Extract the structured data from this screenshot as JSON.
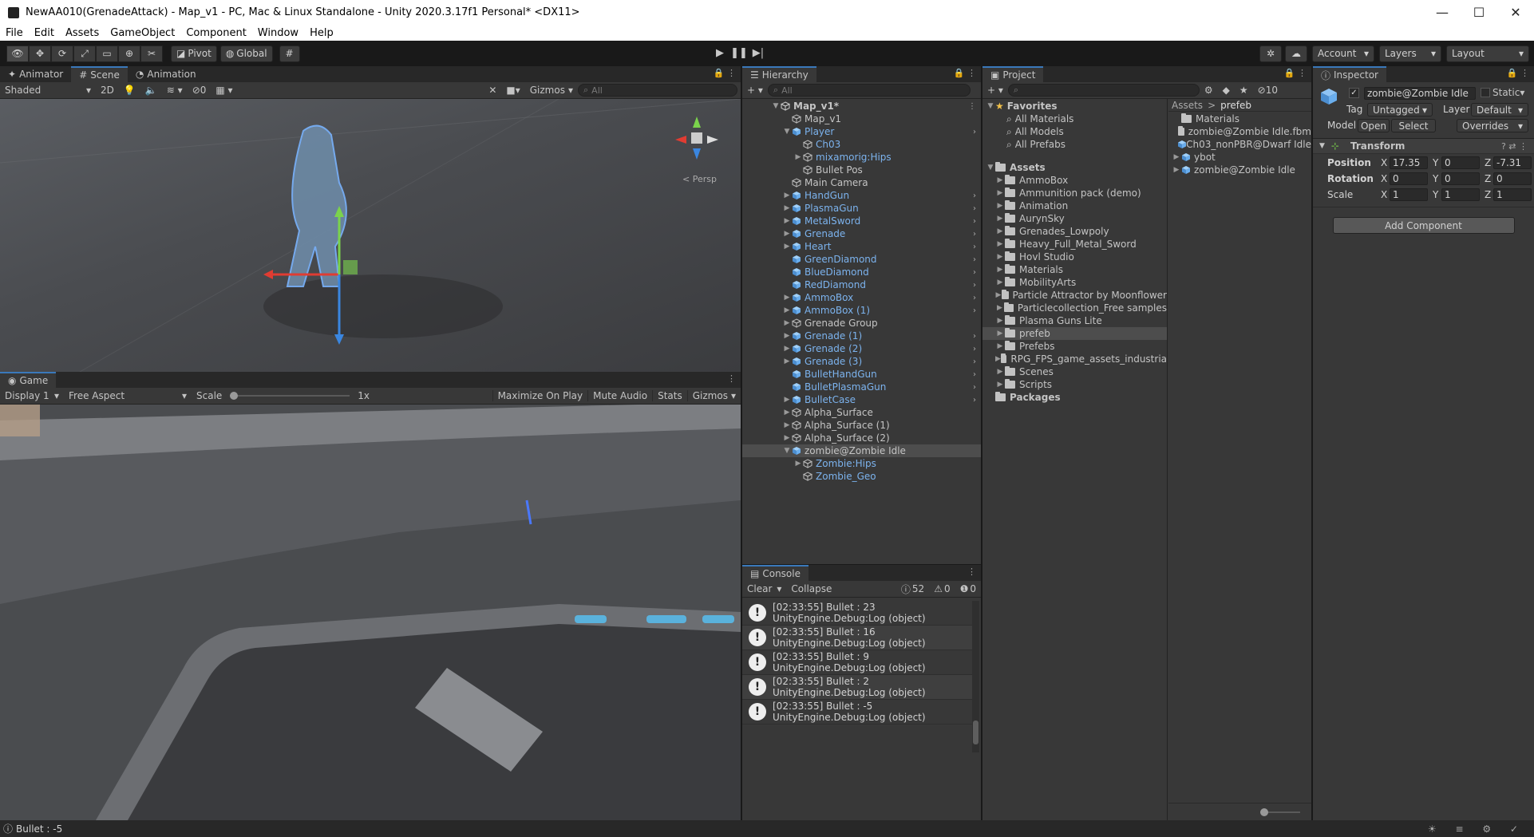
{
  "window": {
    "title": "NewAA010(GrenadeAttack) - Map_v1 - PC, Mac & Linux Standalone - Unity 2020.3.17f1 Personal* <DX11>",
    "minimize": "—",
    "maximize": "☐",
    "close": "✕"
  },
  "menu": [
    "File",
    "Edit",
    "Assets",
    "GameObject",
    "Component",
    "Window",
    "Help"
  ],
  "toolbar": {
    "pivot": "Pivot",
    "global": "Global",
    "account": "Account",
    "layers": "Layers",
    "layout": "Layout"
  },
  "scene": {
    "tabs": [
      "Animator",
      "Scene",
      "Animation"
    ],
    "shading": "Shaded",
    "mode2d": "2D",
    "hidden_count": "0",
    "gizmos": "Gizmos",
    "search_placeholder": "All",
    "persp": "< Persp"
  },
  "game": {
    "tab": "Game",
    "display": "Display 1",
    "aspect": "Free Aspect",
    "scale_label": "Scale",
    "scale_value": "1x",
    "maximize": "Maximize On Play",
    "mute": "Mute Audio",
    "stats": "Stats",
    "gizmos": "Gizmos"
  },
  "hierarchy": {
    "tab": "Hierarchy",
    "search_placeholder": "All",
    "items": [
      {
        "label": "Map_v1*",
        "indent": 0,
        "arrow": "▼",
        "icon": "scene",
        "bold": true
      },
      {
        "label": "Map_v1",
        "indent": 1,
        "arrow": "",
        "icon": "cube"
      },
      {
        "label": "Player",
        "indent": 1,
        "arrow": "▼",
        "icon": "prefab",
        "blue": true,
        "chev": true
      },
      {
        "label": "Ch03",
        "indent": 2,
        "arrow": "",
        "icon": "cube",
        "blue": true
      },
      {
        "label": "mixamorig:Hips",
        "indent": 2,
        "arrow": "▶",
        "icon": "cube",
        "blue": true
      },
      {
        "label": "Bullet Pos",
        "indent": 2,
        "arrow": "",
        "icon": "cube"
      },
      {
        "label": "Main Camera",
        "indent": 1,
        "arrow": "",
        "icon": "cube"
      },
      {
        "label": "HandGun",
        "indent": 1,
        "arrow": "▶",
        "icon": "prefab",
        "blue": true,
        "chev": true
      },
      {
        "label": "PlasmaGun",
        "indent": 1,
        "arrow": "▶",
        "icon": "prefab",
        "blue": true,
        "chev": true
      },
      {
        "label": "MetalSword",
        "indent": 1,
        "arrow": "▶",
        "icon": "prefab",
        "blue": true,
        "chev": true
      },
      {
        "label": "Grenade",
        "indent": 1,
        "arrow": "▶",
        "icon": "prefab",
        "blue": true,
        "chev": true
      },
      {
        "label": "Heart",
        "indent": 1,
        "arrow": "▶",
        "icon": "prefab",
        "blue": true,
        "chev": true
      },
      {
        "label": "GreenDiamond",
        "indent": 1,
        "arrow": "",
        "icon": "prefab",
        "blue": true,
        "chev": true
      },
      {
        "label": "BlueDiamond",
        "indent": 1,
        "arrow": "",
        "icon": "prefab",
        "blue": true,
        "chev": true
      },
      {
        "label": "RedDiamond",
        "indent": 1,
        "arrow": "",
        "icon": "prefab",
        "blue": true,
        "chev": true
      },
      {
        "label": "AmmoBox",
        "indent": 1,
        "arrow": "▶",
        "icon": "prefab",
        "blue": true,
        "chev": true
      },
      {
        "label": "AmmoBox (1)",
        "indent": 1,
        "arrow": "▶",
        "icon": "prefab",
        "blue": true,
        "chev": true
      },
      {
        "label": "Grenade Group",
        "indent": 1,
        "arrow": "▶",
        "icon": "cube"
      },
      {
        "label": "Grenade (1)",
        "indent": 1,
        "arrow": "▶",
        "icon": "prefab",
        "blue": true,
        "chev": true
      },
      {
        "label": "Grenade (2)",
        "indent": 1,
        "arrow": "▶",
        "icon": "prefab",
        "blue": true,
        "chev": true
      },
      {
        "label": "Grenade (3)",
        "indent": 1,
        "arrow": "▶",
        "icon": "prefab",
        "blue": true,
        "chev": true
      },
      {
        "label": "BulletHandGun",
        "indent": 1,
        "arrow": "",
        "icon": "prefab",
        "blue": true,
        "chev": true
      },
      {
        "label": "BulletPlasmaGun",
        "indent": 1,
        "arrow": "",
        "icon": "prefab",
        "blue": true,
        "chev": true
      },
      {
        "label": "BulletCase",
        "indent": 1,
        "arrow": "▶",
        "icon": "prefab",
        "blue": true,
        "chev": true
      },
      {
        "label": "Alpha_Surface",
        "indent": 1,
        "arrow": "▶",
        "icon": "cube"
      },
      {
        "label": "Alpha_Surface (1)",
        "indent": 1,
        "arrow": "▶",
        "icon": "cube"
      },
      {
        "label": "Alpha_Surface (2)",
        "indent": 1,
        "arrow": "▶",
        "icon": "cube"
      },
      {
        "label": "zombie@Zombie Idle",
        "indent": 1,
        "arrow": "▼",
        "icon": "prefab",
        "selected": true
      },
      {
        "label": "Zombie:Hips",
        "indent": 2,
        "arrow": "▶",
        "icon": "cube",
        "blue": true
      },
      {
        "label": "Zombie_Geo",
        "indent": 2,
        "arrow": "",
        "icon": "cube",
        "blue": true
      }
    ]
  },
  "project": {
    "tab": "Project",
    "hidden_count": "10",
    "favorites_label": "Favorites",
    "favorites": [
      "All Materials",
      "All Models",
      "All Prefabs"
    ],
    "assets_label": "Assets",
    "folders": [
      "AmmoBox",
      "Ammunition pack (demo)",
      "Animation",
      "AurynSky",
      "Grenades_Lowpoly",
      "Heavy_Full_Metal_Sword",
      "Hovl Studio",
      "Materials",
      "MobilityArts",
      "Particle Attractor by Moonflower",
      "Particlecollection_Free samples",
      "Plasma Guns Lite",
      "prefeb",
      "Prefebs",
      "RPG_FPS_game_assets_industria",
      "Scenes",
      "Scripts"
    ],
    "selected_folder": "prefeb",
    "packages_label": "Packages",
    "breadcrumb_root": "Assets",
    "breadcrumb_sep": ">",
    "breadcrumb_current": "prefeb",
    "contents": [
      {
        "label": "Materials",
        "icon": "folder"
      },
      {
        "label": "zombie@Zombie Idle.fbm",
        "icon": "folder"
      },
      {
        "label": "Ch03_nonPBR@Dwarf Idle",
        "icon": "prefab"
      },
      {
        "label": "ybot",
        "icon": "prefab",
        "arrow": true
      },
      {
        "label": "zombie@Zombie Idle",
        "icon": "prefab",
        "arrow": true
      }
    ]
  },
  "console": {
    "tab": "Console",
    "clear": "Clear",
    "collapse": "Collapse",
    "log_count": "52",
    "warn_count": "0",
    "error_count": "0",
    "messages": [
      {
        "line1": "[02:33:55] Bullet : 23",
        "line2": "UnityEngine.Debug:Log (object)"
      },
      {
        "line1": "[02:33:55] Bullet : 16",
        "line2": "UnityEngine.Debug:Log (object)"
      },
      {
        "line1": "[02:33:55] Bullet : 9",
        "line2": "UnityEngine.Debug:Log (object)"
      },
      {
        "line1": "[02:33:55] Bullet : 2",
        "line2": "UnityEngine.Debug:Log (object)"
      },
      {
        "line1": "[02:33:55] Bullet : -5",
        "line2": "UnityEngine.Debug:Log (object)"
      }
    ]
  },
  "inspector": {
    "tab": "Inspector",
    "object_name": "zombie@Zombie Idle",
    "static": "Static",
    "tag_label": "Tag",
    "tag": "Untagged",
    "layer_label": "Layer",
    "layer": "Default",
    "model_label": "Model",
    "open": "Open",
    "select": "Select",
    "overrides": "Overrides",
    "transform_label": "Transform",
    "position_label": "Position",
    "position": {
      "x": "17.35",
      "y": "0",
      "z": "-7.31"
    },
    "rotation_label": "Rotation",
    "rotation": {
      "x": "0",
      "y": "0",
      "z": "0"
    },
    "scale_label": "Scale",
    "scale": {
      "x": "1",
      "y": "1",
      "z": "1"
    },
    "axis_x": "X",
    "axis_y": "Y",
    "axis_z": "Z",
    "add_component": "Add Component"
  },
  "status": {
    "message": "Bullet : -5"
  },
  "colors": {
    "accent": "#3a79bb",
    "prefab_blue": "#7cb3ee",
    "panel": "#383838"
  }
}
